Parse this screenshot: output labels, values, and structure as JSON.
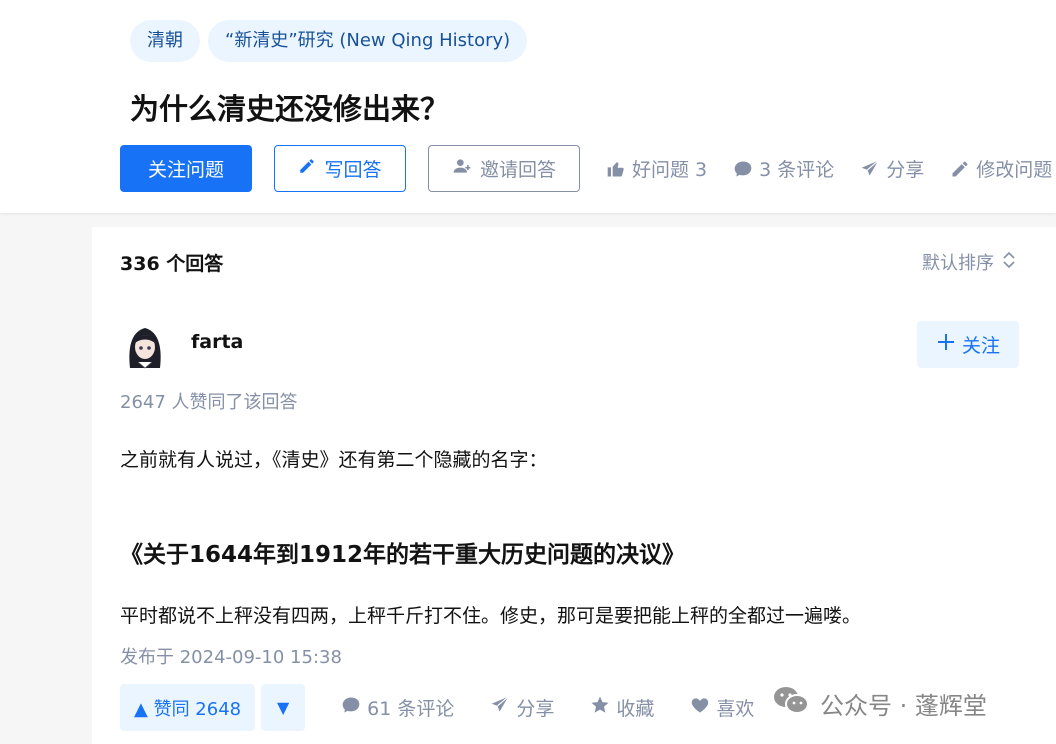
{
  "header": {
    "tags": [
      "清朝",
      "“新清史”研究 (New Qing History)"
    ],
    "title": "为什么清史还没修出来？",
    "follow_question_label": "关注问题",
    "write_answer_label": "写回答",
    "invite_answer_label": "邀请回答",
    "good_question_label": "好问题 3",
    "comments_label": "3 条评论",
    "share_label": "分享",
    "edit_label": "修改问题"
  },
  "answers": {
    "count_label": "336 个回答",
    "sort_label": "默认排序"
  },
  "answer": {
    "author_name": "farta",
    "follow_label": "关注",
    "upvote_note": "2647 人赞同了该回答",
    "paragraph_1": "之前就有人说过，《清史》还有第二个隐藏的名字：",
    "heading": "《关于1644年到1912年的若干重大历史问题的决议》",
    "paragraph_2": "平时都说不上秤没有四两，上秤千斤打不住。修史，那可是要把能上秤的全都过一遍喽。",
    "publish_time": "发布于 2024-09-10 15:38",
    "upvote_label": "▲ 赞同 2648",
    "downvote_symbol": "▼",
    "comments_label": "61 条评论",
    "share_label": "分享",
    "collect_label": "收藏",
    "like_label": "喜欢"
  },
  "watermark": {
    "text": "公众号 · 蓬辉堂"
  },
  "colors": {
    "brand_blue": "#1772f6",
    "tag_bg": "#ebf5ff",
    "tag_text": "#175199",
    "meta_gray": "#8590a6"
  }
}
